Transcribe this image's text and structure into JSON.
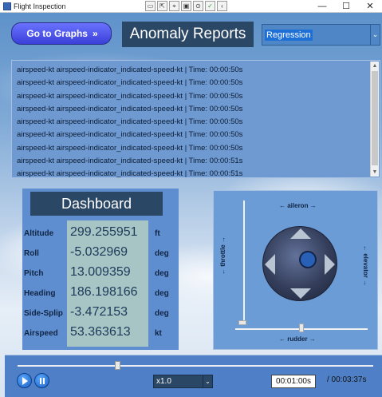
{
  "window": {
    "title": "Flight Inspection",
    "toolbar_icons": [
      "pointer-icon",
      "select-icon",
      "inspect-icon",
      "layout-icon",
      "binding-icon",
      "check-icon",
      "collapse-icon"
    ],
    "controls": {
      "minimize": "—",
      "maximize": "☐",
      "close": "✕"
    }
  },
  "header": {
    "graphs_button": "Go to Graphs",
    "graphs_chevron": "»",
    "title": "Anomaly Reports",
    "algorithm": {
      "value": "Regression",
      "arrow": "⌄"
    }
  },
  "anomalies": [
    "airspeed-kt airspeed-indicator_indicated-speed-kt | Time: 00:00:50s",
    "airspeed-kt airspeed-indicator_indicated-speed-kt | Time: 00:00:50s",
    "airspeed-kt airspeed-indicator_indicated-speed-kt | Time: 00:00:50s",
    "airspeed-kt airspeed-indicator_indicated-speed-kt | Time: 00:00:50s",
    "airspeed-kt airspeed-indicator_indicated-speed-kt | Time: 00:00:50s",
    "airspeed-kt airspeed-indicator_indicated-speed-kt | Time: 00:00:50s",
    "airspeed-kt airspeed-indicator_indicated-speed-kt | Time: 00:00:50s",
    "airspeed-kt airspeed-indicator_indicated-speed-kt | Time: 00:00:51s",
    "airspeed-kt airspeed-indicator_indicated-speed-kt | Time: 00:00:51s"
  ],
  "dashboard": {
    "title": "Dashboard",
    "rows": [
      {
        "label": "Altitude",
        "value": "299.255951",
        "unit": "ft"
      },
      {
        "label": "Roll",
        "value": "-5.032969",
        "unit": "deg"
      },
      {
        "label": "Pitch",
        "value": "13.009359",
        "unit": "deg"
      },
      {
        "label": "Heading",
        "value": "186.198166",
        "unit": "deg"
      },
      {
        "label": "Side-Splip",
        "value": "-3.472153",
        "unit": "deg"
      },
      {
        "label": "Airspeed",
        "value": "53.363613",
        "unit": "kt"
      }
    ]
  },
  "joystick": {
    "aileron_label": "← aileron →",
    "rudder_label": "← rudder →",
    "throttle_label": "← throttle →",
    "elevator_label": "← elevator →",
    "throttle_level": 0.0,
    "rudder_level": 0.5
  },
  "player": {
    "speed": "x1.0",
    "speed_arrow": "⌄",
    "current_time": "00:01:00s",
    "total_time": "/ 00:03:37s",
    "progress": 0.28
  }
}
